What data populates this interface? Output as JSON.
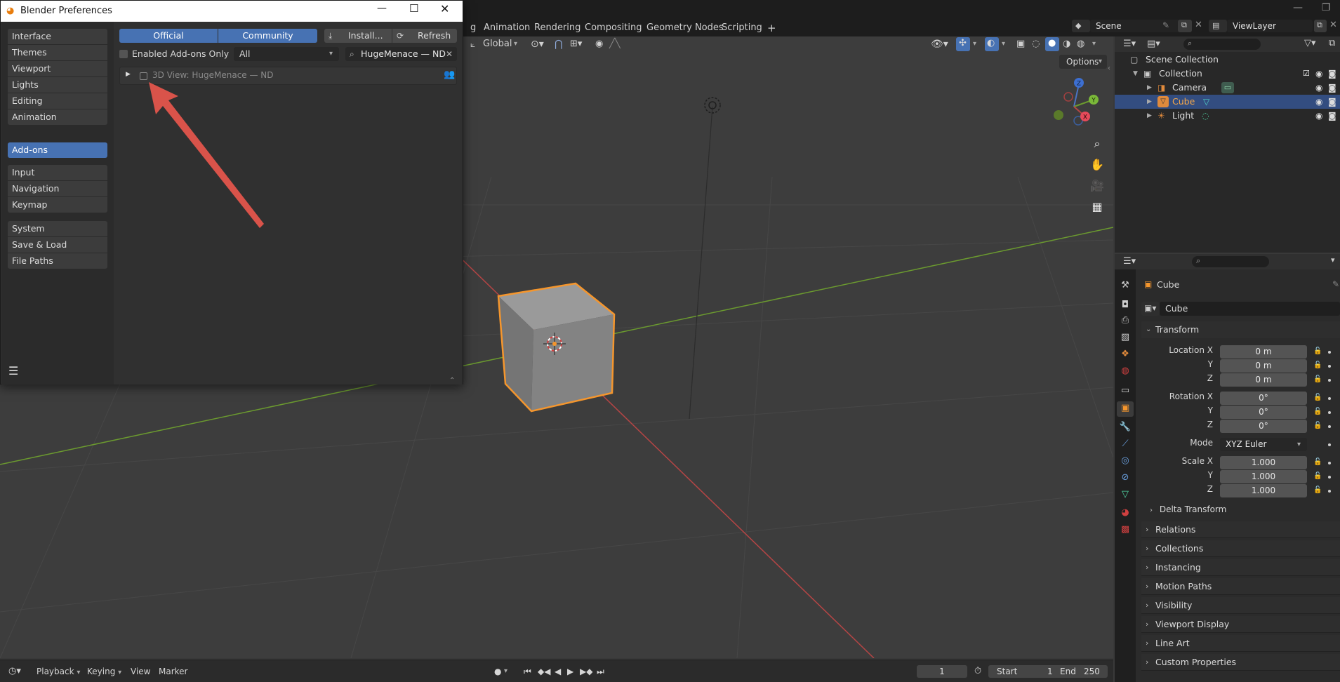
{
  "topbar": {
    "workspace_tabs": [
      "g",
      "Animation",
      "Rendering",
      "Compositing",
      "Geometry Nodes",
      "Scripting"
    ],
    "add_tab": "+",
    "scene_label": "Scene",
    "view_layer_label": "ViewLayer"
  },
  "viewport": {
    "orientation": "Global",
    "options_label": "Options",
    "gizmo": {
      "z": "Z",
      "y": "Y",
      "x": "X"
    }
  },
  "outliner": {
    "rows": [
      {
        "label": "Scene Collection"
      },
      {
        "label": "Collection"
      },
      {
        "label": "Camera"
      },
      {
        "label": "Cube"
      },
      {
        "label": "Light"
      }
    ]
  },
  "properties": {
    "object_name": "Cube",
    "data_name": "Cube",
    "transform_label": "Transform",
    "location_x_label": "Location X",
    "location_y_label": "Y",
    "location_z_label": "Z",
    "location": [
      "0 m",
      "0 m",
      "0 m"
    ],
    "rotation_x_label": "Rotation X",
    "rotation_y_label": "Y",
    "rotation_z_label": "Z",
    "rotation": [
      "0°",
      "0°",
      "0°"
    ],
    "mode_label": "Mode",
    "mode_value": "XYZ Euler",
    "scale_x_label": "Scale X",
    "scale_y_label": "Y",
    "scale_z_label": "Z",
    "scale": [
      "1.000",
      "1.000",
      "1.000"
    ],
    "delta_transform": "Delta Transform",
    "panels": [
      "Relations",
      "Collections",
      "Instancing",
      "Motion Paths",
      "Visibility",
      "Viewport Display",
      "Line Art",
      "Custom Properties"
    ]
  },
  "timeline": {
    "playback": "Playback",
    "keying": "Keying",
    "view": "View",
    "marker": "Marker",
    "current_frame": "1",
    "start_label": "Start",
    "start_value": "1",
    "end_label": "End",
    "end_value": "250"
  },
  "prefs": {
    "title": "Blender Preferences",
    "sidebar": [
      {
        "label": "Interface"
      },
      {
        "label": "Themes"
      },
      {
        "label": "Viewport"
      },
      {
        "label": "Lights"
      },
      {
        "label": "Editing"
      },
      {
        "label": "Animation"
      },
      {
        "label": "Add-ons"
      },
      {
        "label": "Input"
      },
      {
        "label": "Navigation"
      },
      {
        "label": "Keymap"
      },
      {
        "label": "System"
      },
      {
        "label": "Save & Load"
      },
      {
        "label": "File Paths"
      }
    ],
    "official_label": "Official",
    "community_label": "Community",
    "install_label": "Install...",
    "refresh_label": "Refresh",
    "enabled_only_label": "Enabled Add-ons Only",
    "category_value": "All",
    "search_value": "HugeMenace — ND",
    "addon_row_label": "3D View: HugeMenace — ND"
  },
  "colors": {
    "accent": "#4772b3",
    "selection_orange": "#f5962d",
    "annotation_arrow": "#d9534a",
    "x_axis": "#b54545",
    "y_axis": "#6b9a2f"
  }
}
